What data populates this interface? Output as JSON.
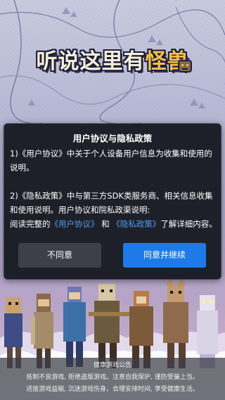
{
  "game": {
    "logo_text_part1": "听说这里有",
    "logo_text_part2": "怪兽"
  },
  "privacy_dialog": {
    "title": "用户协议与隐私政策",
    "para1": "1)《用户协议》中关于个人设备用户信息为收集和使用的说明。",
    "para2": "2)《隐私政策》中与第三方SDK类服务商、相关信息收集和使用说明。用户协议和院私政渠说明:",
    "para3_prefix": "阅读完整的",
    "user_agreement_link": "《用户协议》",
    "and_text": "和",
    "privacy_policy_link": "《隐私政策》",
    "para3_suffix": "了解详细内容。",
    "disagree_label": "不同意",
    "agree_label": "同意并继续"
  },
  "health_notice": {
    "title": "健康游戏公告",
    "line1": "抵制不良游戏, 拒绝盗版游戏。注意自我保护, 谨防受骗上当。",
    "line2": "适度游戏益脑, 沉迷游戏伤身。合理安排时间, 享受健康生活。"
  },
  "colors": {
    "dialog_bg": "#1e2029",
    "link": "#4f9bf0",
    "agree_button": "#1e7ae6",
    "disagree_button": "#3e3f48"
  },
  "icons": {
    "logo_mascot": "monster-head-icon"
  }
}
